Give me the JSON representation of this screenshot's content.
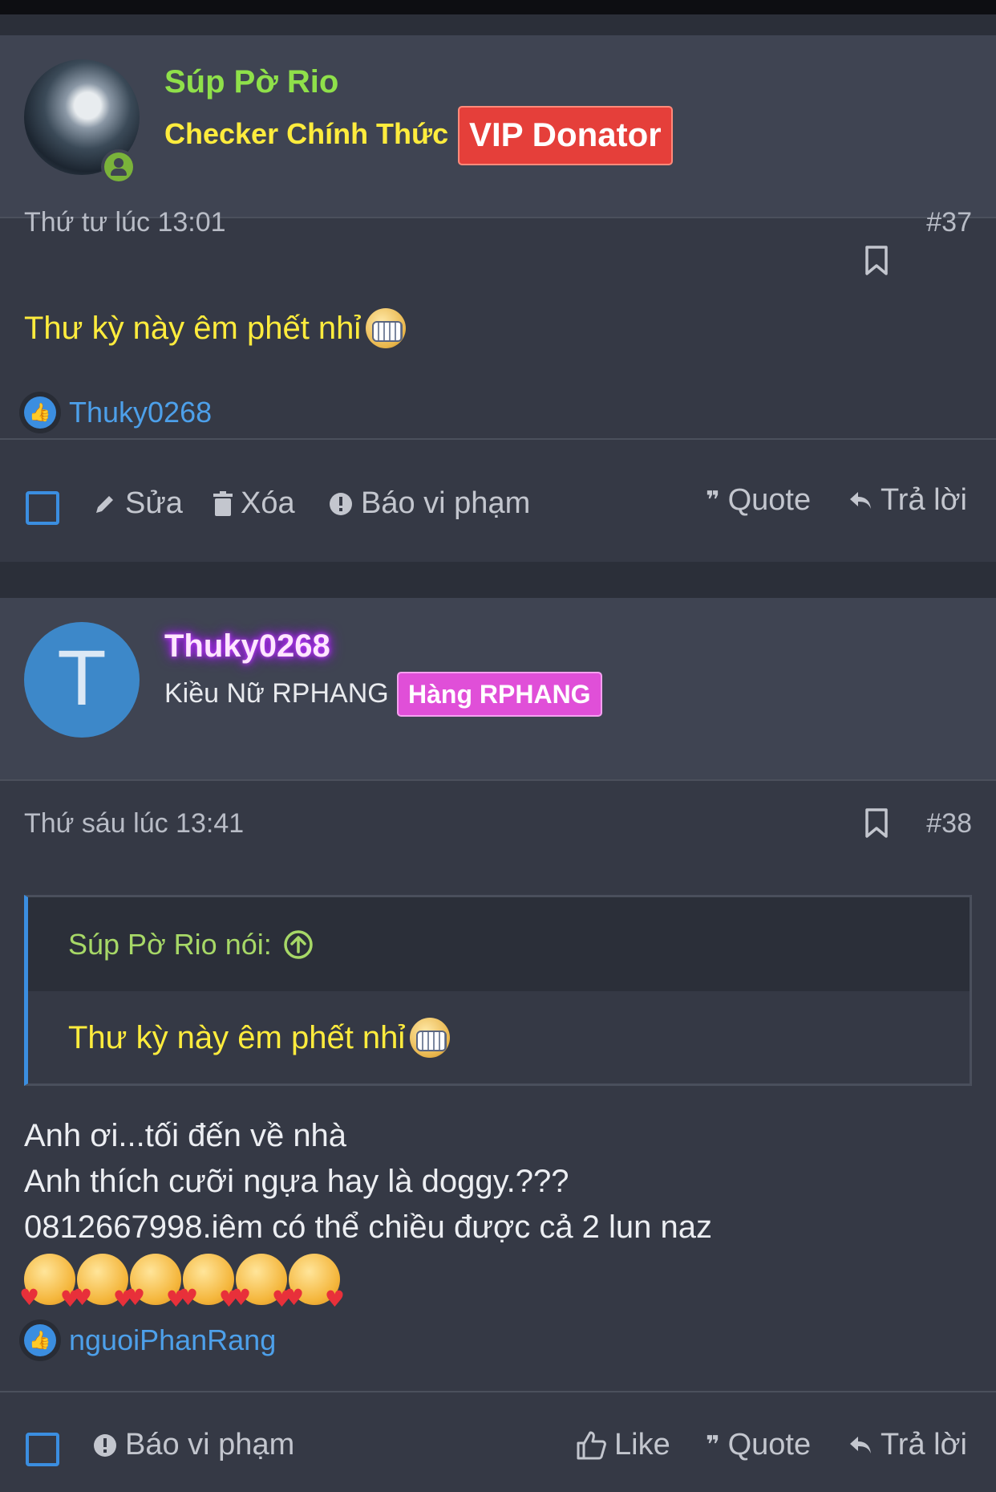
{
  "posts": [
    {
      "username": "Súp Pờ Rio",
      "user_title": "Checker Chính Thức",
      "badge": "VIP Donator",
      "timestamp": "Thứ tư lúc 13:01",
      "post_number": "#37",
      "message": "Thư kỳ này êm phết nhỉ",
      "reactions": {
        "user": "Thuky0268"
      },
      "actions": {
        "edit": "Sửa",
        "delete": "Xóa",
        "report": "Báo vi phạm",
        "quote": "Quote",
        "reply": "Trả lời"
      }
    },
    {
      "username": "Thuky0268",
      "avatar_letter": "T",
      "user_title": "Kiều Nữ RPHANG",
      "badge": "Hàng RPHANG",
      "timestamp": "Thứ sáu lúc 13:41",
      "post_number": "#38",
      "quote": {
        "author": "Súp Pờ Rio nói:",
        "text": "Thư kỳ này êm phết nhỉ"
      },
      "content": [
        "Anh ơi...tối đến về nhà",
        "Anh thích cưỡi ngựa hay là doggy.???",
        "0812667998.iêm có thể chiều được cả 2 lun naz"
      ],
      "reactions": {
        "user": "nguoiPhanRang"
      },
      "actions": {
        "report": "Báo vi phạm",
        "like": "Like",
        "quote": "Quote",
        "reply": "Trả lời"
      }
    }
  ],
  "colors": {
    "accent": "#3b8ee0",
    "username_green": "#8fe04a",
    "title_yellow": "#ffec3d",
    "badge_vip": "#e53f3a",
    "badge_hang": "#e04fd8",
    "background": "#2b2f39"
  }
}
